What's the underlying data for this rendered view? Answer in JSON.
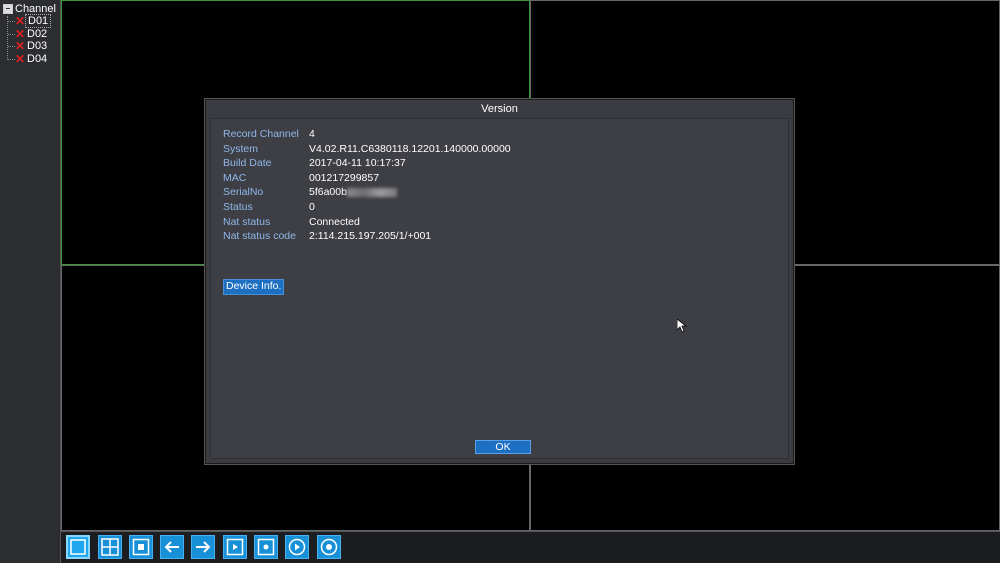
{
  "sidebar": {
    "title": "Channel",
    "channels": [
      {
        "label": "D01",
        "selected": true,
        "status_icon": "red-x-icon"
      },
      {
        "label": "D02",
        "selected": false,
        "status_icon": "red-x-icon"
      },
      {
        "label": "D03",
        "selected": false,
        "status_icon": "red-x-icon"
      },
      {
        "label": "D04",
        "selected": false,
        "status_icon": "red-x-icon"
      }
    ]
  },
  "dialog": {
    "title": "Version",
    "rows": [
      {
        "label": "Record Channel",
        "value": "4"
      },
      {
        "label": "System",
        "value": "V4.02.R11.C6380118.12201.140000.00000"
      },
      {
        "label": "Build Date",
        "value": "2017-04-11 10:17:37"
      },
      {
        "label": "MAC",
        "value": "001217299857"
      },
      {
        "label": "SerialNo",
        "value": "5f6a00b"
      },
      {
        "label": "Status",
        "value": "0"
      },
      {
        "label": "Nat status",
        "value": "Connected"
      },
      {
        "label": "Nat status code",
        "value": "2:114.215.197.205/1/+001"
      }
    ],
    "device_info_label": "Device Info.",
    "ok_label": "OK"
  },
  "toolbar": {
    "buttons": [
      {
        "name": "single-view-button",
        "icon": "single-square-icon"
      },
      {
        "name": "quad-view-button",
        "icon": "quad-grid-icon"
      },
      {
        "name": "fullscreen-button",
        "icon": "fullscreen-icon"
      },
      {
        "name": "previous-button",
        "icon": "arrow-left-icon"
      },
      {
        "name": "next-button",
        "icon": "arrow-right-icon"
      },
      {
        "name": "playback-button",
        "icon": "play-square-icon"
      },
      {
        "name": "record-button",
        "icon": "record-square-icon"
      },
      {
        "name": "play-circle-button",
        "icon": "play-circle-icon"
      },
      {
        "name": "record-circle-button",
        "icon": "record-circle-icon"
      }
    ]
  },
  "colors": {
    "accent": "#1890d8",
    "label_blue": "#8fb7ea",
    "active_border": "#3a9a3a",
    "error": "#e02020"
  }
}
